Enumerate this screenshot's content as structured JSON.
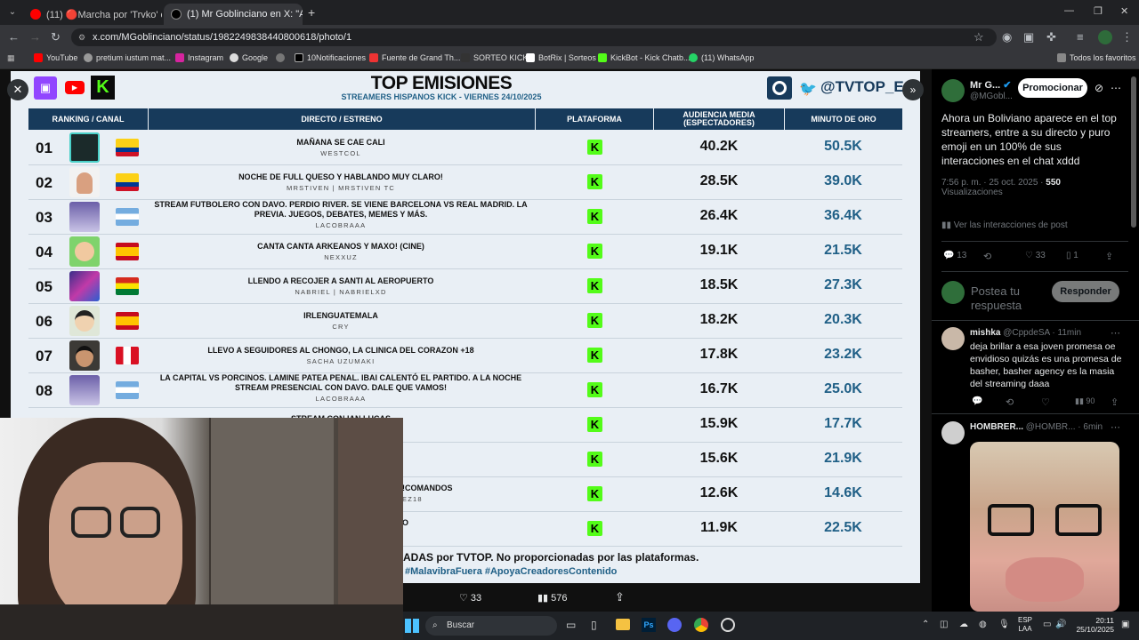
{
  "browser": {
    "tabs": [
      {
        "label": "(11) 🔴Marcha por 'Trvko' en v"
      },
      {
        "label": "(1) Mr Goblinciano en X: \"Ahora"
      }
    ],
    "url": "x.com/MGoblinciano/status/1982249838440800618/photo/1",
    "bookmarks": [
      "YouTube",
      "pretium iustum mat...",
      "Instagram",
      "Google",
      "10Notificaciones",
      "Fuente de Grand Th...",
      "SORTEO KICK",
      "BotRix | Sorteos",
      "KickBot - Kick Chatb...",
      "(11) WhatsApp"
    ],
    "all_favorites": "Todos los favoritos"
  },
  "infographic": {
    "title": "TOP EMISIONES",
    "subtitle": "STREAMERS HISPANOS KICK - VIERNES 24/10/2025",
    "handle": "@TVTOP_ES",
    "columns": {
      "rank": "RANKING / CANAL",
      "stream": "DIRECTO / ESTRENO",
      "platform": "PLATAFORMA",
      "audience": "AUDIENCIA MEDIA (ESPECTADORES)",
      "gold": "MINUTO DE ORO"
    },
    "rows": [
      {
        "rank": "01",
        "title": "MAÑANA SE CAE CALI",
        "channel": "WESTCOL",
        "audience": "40.2K",
        "gold": "50.5K"
      },
      {
        "rank": "02",
        "title": "NOCHE DE FULL QUESO Y HABLANDO MUY CLARO!",
        "channel": "MRSTIVEN | MRSTIVEN TC",
        "audience": "28.5K",
        "gold": "39.0K"
      },
      {
        "rank": "03",
        "title": "STREAM FUTBOLERO CON DAVO. PERDIO RIVER. SE VIENE BARCELONA VS REAL MADRID. LA PREVIA. JUEGOS, DEBATES, MEMES Y MÁS.",
        "channel": "LACOBRAAA",
        "audience": "26.4K",
        "gold": "36.4K"
      },
      {
        "rank": "04",
        "title": "CANTA CANTA ARKEANOS Y MAXO! (CINE)",
        "channel": "NEXXUZ",
        "audience": "19.1K",
        "gold": "21.5K"
      },
      {
        "rank": "05",
        "title": "LLENDO A RECOJER A SANTI AL AEROPUERTO",
        "channel": "NABRIEL | NABRIELXD",
        "audience": "18.5K",
        "gold": "27.3K"
      },
      {
        "rank": "06",
        "title": "IRLENGUATEMALA",
        "channel": "CRY",
        "audience": "18.2K",
        "gold": "20.3K"
      },
      {
        "rank": "07",
        "title": "LLEVO A SEGUIDORES AL CHONGO, LA CLINICA DEL CORAZON +18",
        "channel": "SACHA UZUMAKI",
        "audience": "17.8K",
        "gold": "23.2K"
      },
      {
        "rank": "08",
        "title": "LA CAPITAL VS PORCINOS. LAMINE PATEA PENAL. IBAI CALENTÓ EL PARTIDO. A LA NOCHE STREAM PRESENCIAL CON DAVO. DALE QUE VAMOS!",
        "channel": "LACOBRAAA",
        "audience": "16.7K",
        "gold": "25.0K"
      },
      {
        "rank": "",
        "title": "STREAM CON IAN LUCAS",
        "channel": "",
        "audience": "15.9K",
        "gold": "17.7K"
      },
      {
        "rank": "",
        "title": "",
        "channel": "",
        "audience": "15.6K",
        "gold": "21.9K"
      },
      {
        "rank": "",
        "title": "!COMANDOS",
        "channel": "EZ18",
        "audience": "12.6K",
        "gold": "14.6K"
      },
      {
        "rank": "",
        "title": "O",
        "channel": "",
        "audience": "11.9K",
        "gold": "22.5K"
      }
    ],
    "footer1": "ADAS por TVTOP. No proporcionadas por las plataformas.",
    "footer2": "#MalavibraFuera #ApoyaCreadoresContenido",
    "stats": {
      "likes": "33",
      "views": "576"
    }
  },
  "tweet": {
    "author": "Mr G...",
    "handle": "@MGobl...",
    "promote": "Promocionar",
    "text": "Ahora un Boliviano aparece en el top streamers, entre a su directo y puro emoji en un 100% de sus interacciones en el chat xddd",
    "time": "7:56 p. m. · 25 oct. 2025 · ",
    "views_count": "550",
    "views_label": "Visualizaciones",
    "interactions": "Ver las interacciones de post",
    "actions": {
      "replies": "13",
      "likes": "33",
      "bookmarks": "1"
    },
    "reply_placeholder": "Postea tu respuesta",
    "reply_button": "Responder",
    "replies": [
      {
        "name": "mishka",
        "handle": "@CppdeSA · 11min",
        "text": "deja brillar a esa joven promesa oe envidioso quizás es una promesa de basher, basher agency es la masia del streaming daaa",
        "views": "90"
      },
      {
        "name": "HOMBRER...",
        "handle": "@HOMBR... · 6min",
        "text": ""
      }
    ]
  },
  "taskbar": {
    "search": "Buscar",
    "lang1": "ESP",
    "lang2": "LAA",
    "time": "20:11",
    "date": "25/10/2025"
  },
  "colors": {
    "kick_green": "#53fc18",
    "header_blue": "#173a5b",
    "gold_blue": "#1f5f86"
  }
}
